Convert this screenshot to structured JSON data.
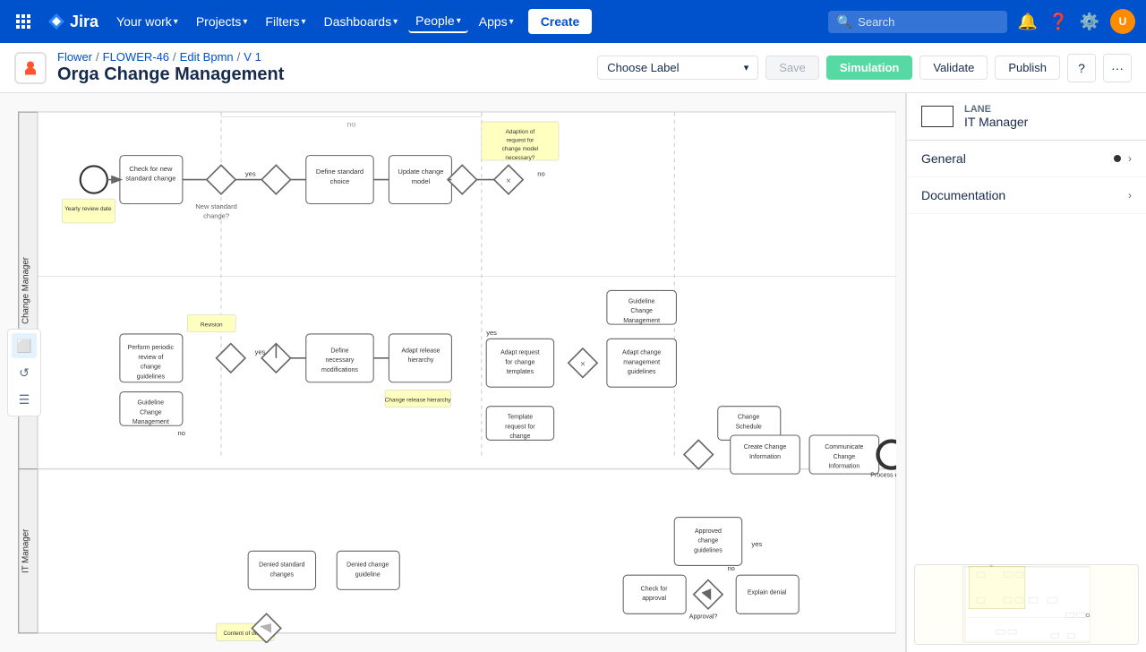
{
  "topnav": {
    "logo_text": "Jira",
    "nav_items": [
      {
        "label": "Your work",
        "has_arrow": true
      },
      {
        "label": "Projects",
        "has_arrow": true
      },
      {
        "label": "Filters",
        "has_arrow": true
      },
      {
        "label": "Dashboards",
        "has_arrow": true
      },
      {
        "label": "People",
        "has_arrow": true
      },
      {
        "label": "Apps",
        "has_arrow": true
      }
    ],
    "create_label": "Create",
    "search_placeholder": "Search"
  },
  "breadcrumb": {
    "project_name": "Flower",
    "issue_id": "FLOWER-46",
    "section": "Edit Bpmn",
    "version": "V 1"
  },
  "page": {
    "title": "Orga Change Management"
  },
  "toolbar": {
    "label_dropdown": "Choose Label",
    "save_btn": "Save",
    "simulation_btn": "Simulation",
    "validate_btn": "Validate",
    "publish_btn": "Publish",
    "help_btn": "?",
    "more_btn": "···"
  },
  "right_panel": {
    "lane_label": "LANE",
    "lane_name": "IT Manager",
    "sections": [
      {
        "label": "General",
        "has_dot": true
      },
      {
        "label": "Documentation",
        "has_dot": false
      }
    ]
  },
  "colors": {
    "primary": "#0052cc",
    "simulation": "#57d9a3",
    "nav_bg": "#0052cc"
  }
}
